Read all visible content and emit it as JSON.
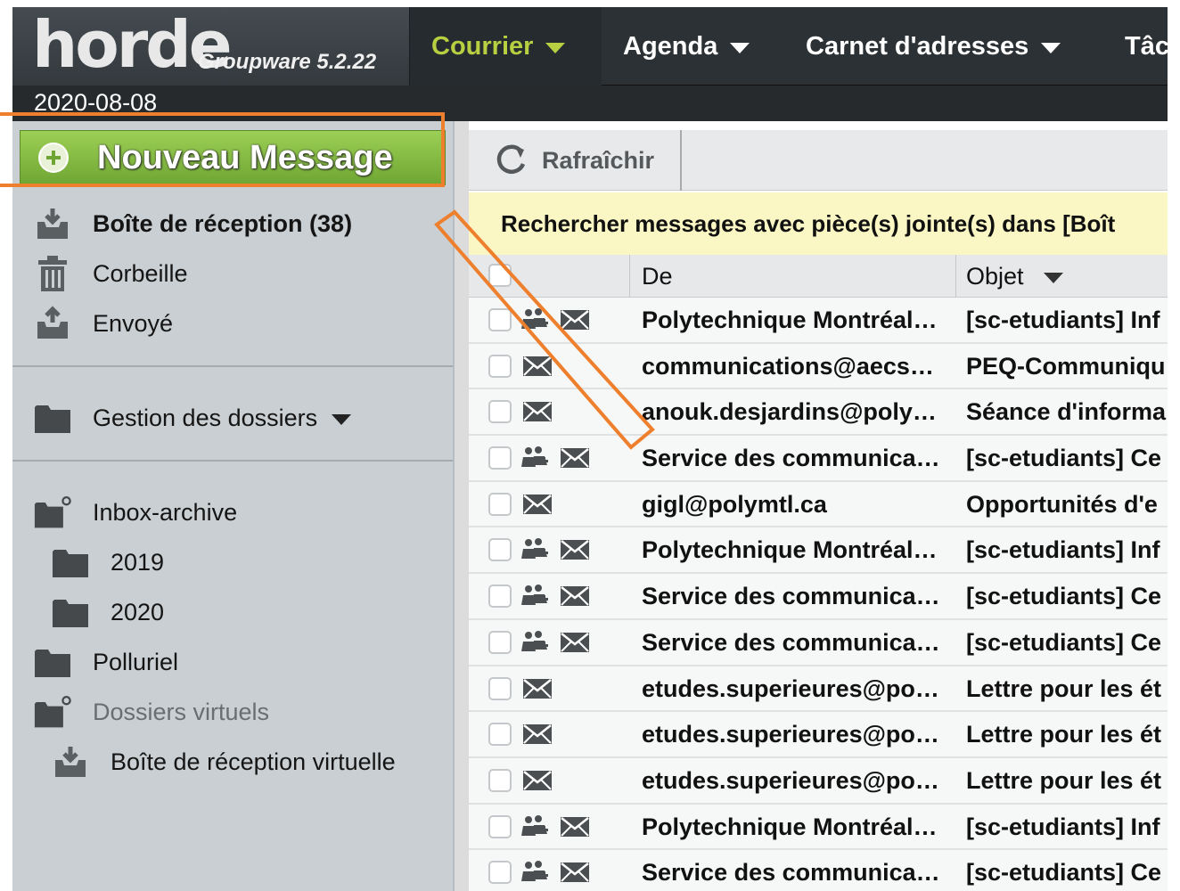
{
  "app": {
    "logo": "horde",
    "product": "Groupware 5.2.22",
    "date": "2020-08-08",
    "nav": [
      {
        "label": "Courrier",
        "active": true
      },
      {
        "label": "Agenda"
      },
      {
        "label": "Carnet d'adresses"
      },
      {
        "label": "Tâc"
      }
    ]
  },
  "sidebar": {
    "new_message": "Nouveau Message",
    "folders_top": [
      {
        "label": "Boîte de réception (38)",
        "icon": "inbox-icon",
        "bold": true
      },
      {
        "label": "Corbeille",
        "icon": "trash-icon"
      },
      {
        "label": "Envoyé",
        "icon": "outbox-icon"
      }
    ],
    "manage": "Gestion des dossiers",
    "folders_bottom": [
      {
        "label": "Inbox-archive",
        "icon": "folder-open-icon"
      },
      {
        "label": "2019",
        "icon": "folder-icon",
        "sub": true
      },
      {
        "label": "2020",
        "icon": "folder-icon",
        "sub": true
      },
      {
        "label": "Polluriel",
        "icon": "folder-icon"
      },
      {
        "label": "Dossiers virtuels",
        "icon": "folder-open-icon",
        "muted": true
      },
      {
        "label": "Boîte de réception virtuelle",
        "icon": "inbox-icon",
        "sub": true
      }
    ]
  },
  "main": {
    "refresh": "Rafraîchir",
    "search_note": "Rechercher messages avec pièce(s) jointe(s) dans [Boît",
    "columns": {
      "from": "De",
      "subject": "Objet"
    },
    "messages": [
      {
        "from": "Polytechnique Montréal…",
        "subject": "[sc-etudiants] Inf",
        "list": true
      },
      {
        "from": "communications@aecs…",
        "subject": "PEQ-Communiqu",
        "list": false
      },
      {
        "from": "anouk.desjardins@poly…",
        "subject": "Séance d'informa",
        "list": false
      },
      {
        "from": "Service des communica…",
        "subject": "[sc-etudiants] Ce",
        "list": true
      },
      {
        "from": "gigl@polymtl.ca",
        "subject": "Opportunités d'e",
        "list": false
      },
      {
        "from": "Polytechnique Montréal…",
        "subject": "[sc-etudiants] Inf",
        "list": true
      },
      {
        "from": "Service des communica…",
        "subject": "[sc-etudiants] Ce",
        "list": true
      },
      {
        "from": "Service des communica…",
        "subject": "[sc-etudiants] Ce",
        "list": true
      },
      {
        "from": "etudes.superieures@po…",
        "subject": "Lettre pour les ét",
        "list": false
      },
      {
        "from": "etudes.superieures@po…",
        "subject": "Lettre pour les ét",
        "list": false
      },
      {
        "from": "etudes.superieures@po…",
        "subject": "Lettre pour les ét",
        "list": false
      },
      {
        "from": "Polytechnique Montréal…",
        "subject": "[sc-etudiants] Inf",
        "list": true
      },
      {
        "from": "Service des communica…",
        "subject": "[sc-etudiants] Ce",
        "list": true
      }
    ]
  },
  "colors": {
    "accent_nav": "#b7cf41",
    "new_message_green": "#6fa633",
    "highlight_orange": "#ee7f2d",
    "search_note_bg": "#fbf7c4"
  }
}
